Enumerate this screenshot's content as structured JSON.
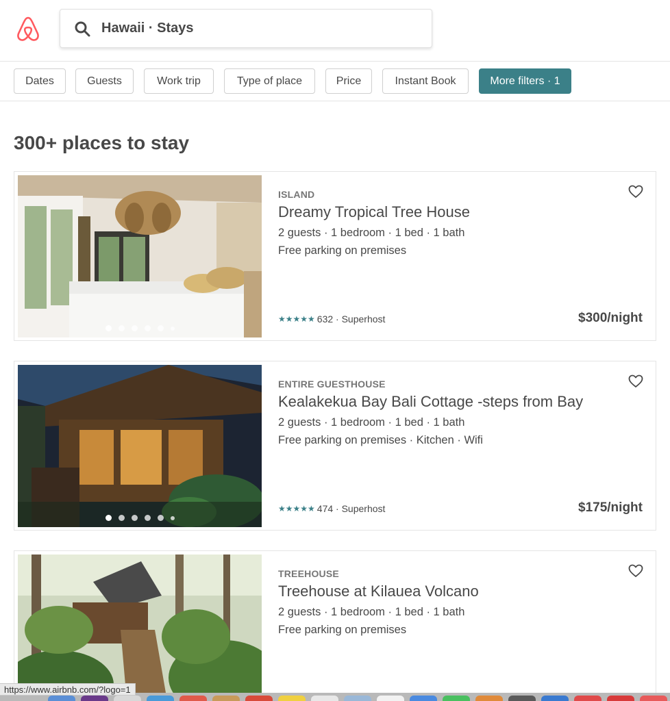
{
  "search": {
    "text": "Hawaii · Stays"
  },
  "filters": [
    "Dates",
    "Guests",
    "Work trip",
    "Type of place",
    "Price",
    "Instant Book",
    "More filters · 1"
  ],
  "results_count": "300+ places to stay",
  "listings": [
    {
      "kind": "ISLAND",
      "title": "Dreamy Tropical Tree House",
      "specs": "2 guests · 1 bedroom · 1 bed · 1 bath",
      "amenities": "Free parking on premises",
      "stars": "★★★★★",
      "reviews": "632 · Superhost",
      "price": "$300/night"
    },
    {
      "kind": "ENTIRE GUESTHOUSE",
      "title": "Kealakekua Bay Bali Cottage -steps from Bay",
      "specs": "2 guests · 1 bedroom · 1 bed · 1 bath",
      "amenities": "Free parking on premises · Kitchen · Wifi",
      "stars": "★★★★★",
      "reviews": "474 · Superhost",
      "price": "$175/night"
    },
    {
      "kind": "TREEHOUSE",
      "title": "Treehouse at Kilauea Volcano",
      "specs": "2 guests · 1 bedroom · 1 bed · 1 bath",
      "amenities": "Free parking on premises"
    }
  ],
  "status_url": "https://www.airbnb.com/?logo=1",
  "colors": {
    "brand": "#ff5a5f",
    "accent": "#3b8088",
    "text": "#484848"
  }
}
